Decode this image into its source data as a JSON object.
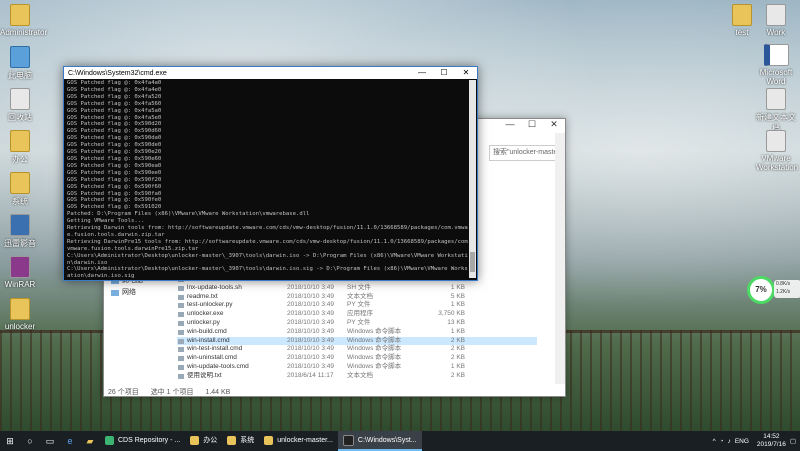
{
  "desktop": {
    "icons_left": [
      {
        "label": "Administrator"
      },
      {
        "label": "此电脑"
      },
      {
        "label": "回收站"
      },
      {
        "label": "办公"
      },
      {
        "label": "系统"
      },
      {
        "label": "迅雷影音"
      },
      {
        "label": "WinRAR"
      },
      {
        "label": "unlocker"
      }
    ],
    "icons_right": [
      {
        "label": "test"
      },
      {
        "label": "Work"
      },
      {
        "label": "Microsoft Word"
      },
      {
        "label": "新建文本文档"
      },
      {
        "label": "VMware Workstation"
      }
    ]
  },
  "cmd_window": {
    "title": "C:\\Windows\\System32\\cmd.exe",
    "minimize": "—",
    "maximize": "☐",
    "close": "✕",
    "lines": [
      "GOS Patched flag @: 0x4fa4a0",
      "GOS Patched flag @: 0x4fa4e0",
      "GOS Patched flag @: 0x4fa520",
      "GOS Patched flag @: 0x4fa560",
      "GOS Patched flag @: 0x4fa5a0",
      "GOS Patched flag @: 0x4fa5e0",
      "GOS Patched flag @: 0x590d20",
      "GOS Patched flag @: 0x590d60",
      "GOS Patched flag @: 0x590da0",
      "GOS Patched flag @: 0x590de0",
      "GOS Patched flag @: 0x590e20",
      "GOS Patched flag @: 0x590e60",
      "GOS Patched flag @: 0x590ea0",
      "GOS Patched flag @: 0x590ee0",
      "GOS Patched flag @: 0x590f20",
      "GOS Patched flag @: 0x590f60",
      "GOS Patched flag @: 0x590fa0",
      "GOS Patched flag @: 0x590fe0",
      "GOS Patched flag @: 0x591020",
      "Patched: D:\\Program Files (x86)\\VMware\\VMware Workstation\\vmwarebase.dll",
      "Getting VMware Tools...",
      "Retrieving Darwin tools from: http://softwareupdate.vmware.com/cds/vmw-desktop/fusion/11.1.0/13668589/packages/com.vmwar",
      "e.fusion.tools.darwin.zip.tar",
      "Retrieving DarwinPre15 tools from: http://softwareupdate.vmware.com/cds/vmw-desktop/fusion/11.1.0/13668589/packages/com.",
      "vmware.fusion.tools.darwinPre15.zip.tar",
      "C:\\Users\\Administrator\\Desktop\\unlocker-master\\_3907\\tools\\darwin.iso -> D:\\Program Files (x86)\\VMware\\VMware Workstatio",
      "n\\darwin.iso",
      "C:\\Users\\Administrator\\Desktop\\unlocker-master\\_3907\\tools\\darwin.iso.sig -> D:\\Program Files (x86)\\VMware\\VMware Workst",
      "ation\\darwin.iso.sig",
      "C:\\Users\\Administrator\\Desktop\\unlocker-master\\_3907\\tools\\darwinPre15.iso -> D:\\Program Files (x86)\\VMware\\VMware Workstat"
    ]
  },
  "explorer_window": {
    "caption_minimize": "—",
    "caption_maximize": "☐",
    "caption_close": "✕",
    "search_placeholder": "搜索\"unlocker-master_398...",
    "nav_items": [
      {
        "label": "此电脑"
      },
      {
        "label": "网络"
      }
    ],
    "files": [
      {
        "name": "linux-uninstall.sh",
        "date": "2018/10/10 3:49",
        "type": "SH 文件",
        "size": "1 KB"
      },
      {
        "name": "lnx-update-tools.sh",
        "date": "2018/10/10 3:49",
        "type": "SH 文件",
        "size": "1 KB"
      },
      {
        "name": "readme.txt",
        "date": "2018/10/10 3:49",
        "type": "文本文档",
        "size": "5 KB"
      },
      {
        "name": "test-unlocker.py",
        "date": "2018/10/10 3:49",
        "type": "PY 文件",
        "size": "1 KB"
      },
      {
        "name": "unlocker.exe",
        "date": "2018/10/10 3:49",
        "type": "应用程序",
        "size": "3,750 KB"
      },
      {
        "name": "unlocker.py",
        "date": "2018/10/10 3:49",
        "type": "PY 文件",
        "size": "13 KB"
      },
      {
        "name": "win-build.cmd",
        "date": "2018/10/10 3:49",
        "type": "Windows 命令脚本",
        "size": "1 KB"
      },
      {
        "name": "win-install.cmd",
        "date": "2018/10/10 3:49",
        "type": "Windows 命令脚本",
        "size": "2 KB"
      },
      {
        "name": "win-test-install.cmd",
        "date": "2018/10/10 3:49",
        "type": "Windows 命令脚本",
        "size": "2 KB"
      },
      {
        "name": "win-uninstall.cmd",
        "date": "2018/10/10 3:49",
        "type": "Windows 命令脚本",
        "size": "2 KB"
      },
      {
        "name": "win-update-tools.cmd",
        "date": "2018/10/10 3:49",
        "type": "Windows 命令脚本",
        "size": "1 KB"
      },
      {
        "name": "使用说明.txt",
        "date": "2018/6/14 11:17",
        "type": "文本文档",
        "size": "2 KB"
      }
    ],
    "selected_index": 7,
    "status": {
      "items_count": "26 个项目",
      "selected_count": "选中 1 个项目",
      "selected_size": "1.44 KB"
    }
  },
  "net_widget": {
    "percent": "7%",
    "upload": "0.8K/s",
    "download": "1.2K/s",
    "ring_color": "#4cd964"
  },
  "taskbar": {
    "start_icon": "windows-icon",
    "apps": [
      {
        "label": "CDS Repository - ...",
        "color": "#3cb371",
        "active": false
      },
      {
        "label": "办公",
        "color": "#e8c45a",
        "active": false
      },
      {
        "label": "系统",
        "color": "#e8c45a",
        "active": false
      },
      {
        "label": "unlocker-master...",
        "color": "#e8c45a",
        "active": false
      },
      {
        "label": "C:\\Windows\\Syst...",
        "color": "#222222",
        "active": true
      }
    ],
    "tray_lang": "ENG",
    "time": "14:52",
    "date": "2019/7/16"
  }
}
